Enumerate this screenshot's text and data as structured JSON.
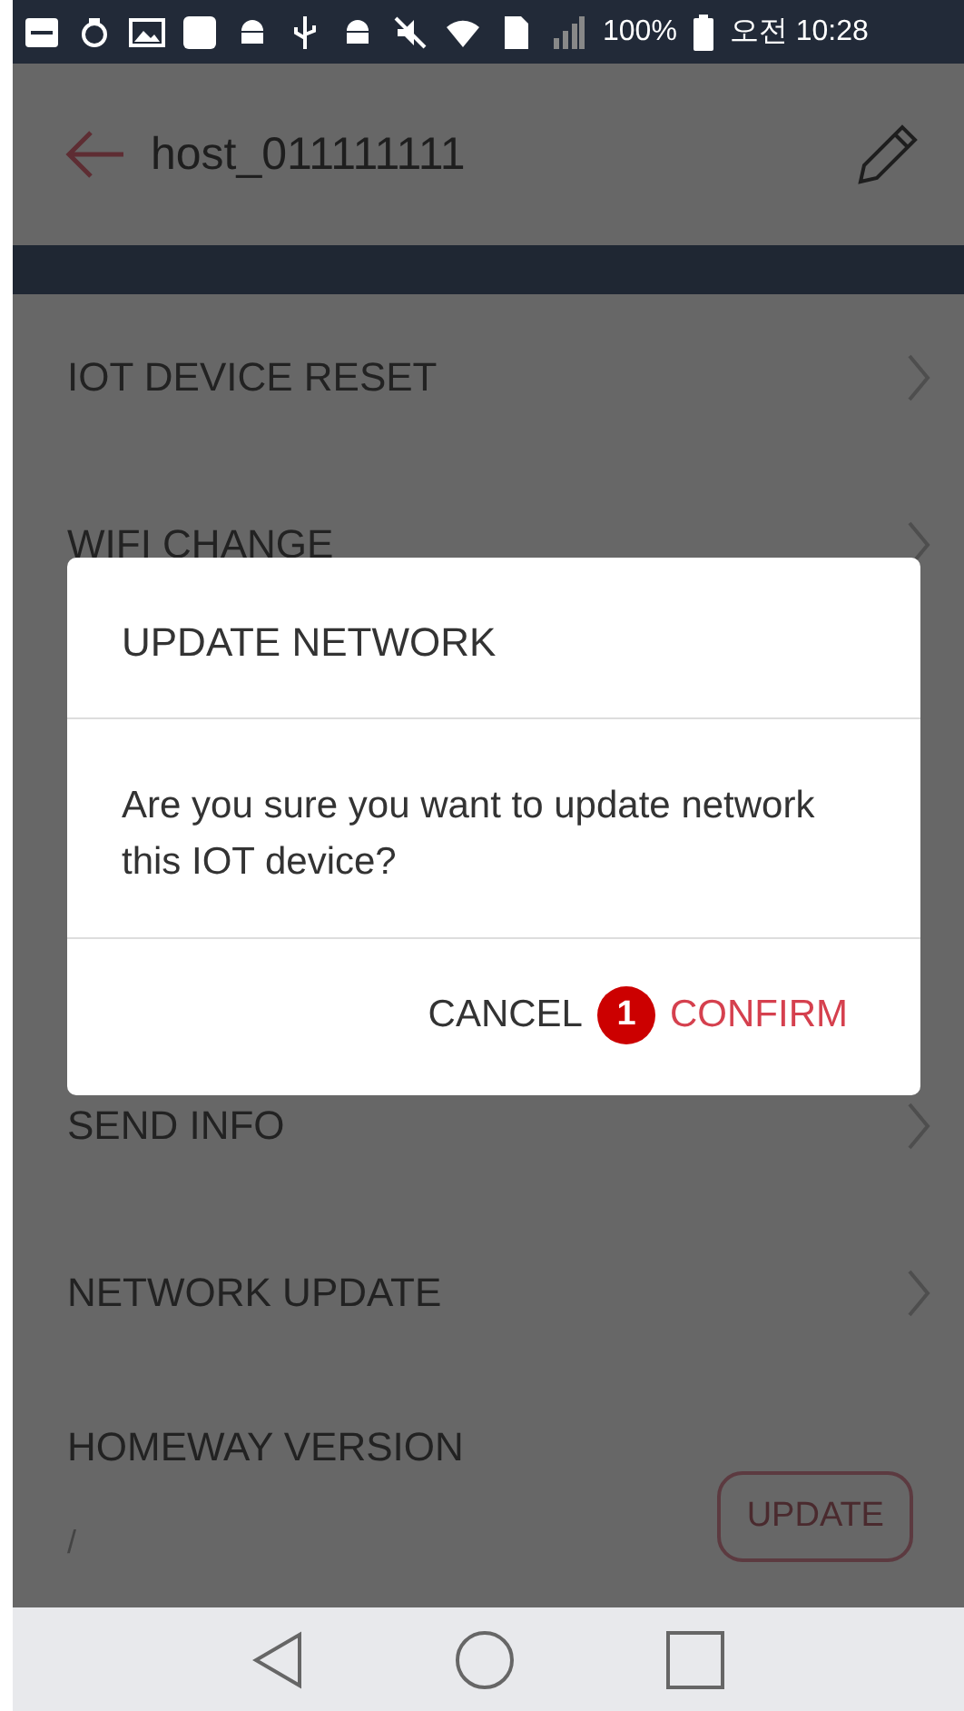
{
  "status_bar": {
    "battery": "100%",
    "time": "오전 10:28"
  },
  "app_bar": {
    "title": "host_011111111"
  },
  "menu": [
    {
      "kind": "link",
      "label": "IOT DEVICE RESET"
    },
    {
      "kind": "link",
      "label": "WIFI CHANGE"
    },
    {
      "kind": "gap"
    },
    {
      "kind": "link",
      "label": "SEND INFO"
    },
    {
      "kind": "link",
      "label": "NETWORK UPDATE"
    },
    {
      "kind": "version",
      "label": "HOMEWAY VERSION",
      "value": "/",
      "button": "UPDATE"
    }
  ],
  "dialog": {
    "title": "UPDATE NETWORK",
    "message": "Are you sure you want to update network this IOT device?",
    "buttons": [
      {
        "kind": "cancel",
        "label": "CANCEL"
      },
      {
        "kind": "confirm",
        "label": "CONFIRM"
      }
    ],
    "marker": "1"
  }
}
